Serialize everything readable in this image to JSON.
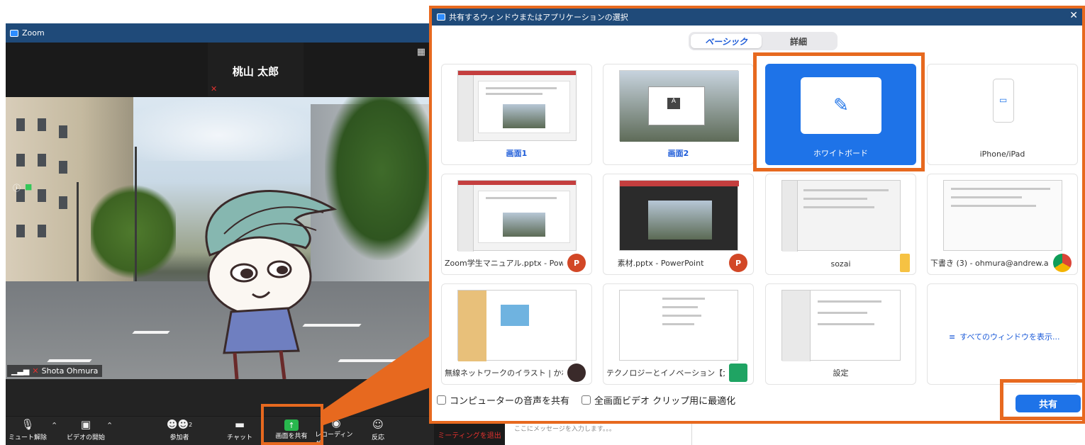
{
  "zoom_window": {
    "title": "Zoom",
    "speaker_name": "桃山 太郎",
    "participant_name": "Shota Ohmura",
    "toolbar": {
      "mute": "ミュート解除",
      "video": "ビデオの開始",
      "participants": "参加者",
      "participants_count": "2",
      "chat": "チャット",
      "share": "画面を共有",
      "record": "レコーディング",
      "reactions": "反応"
    },
    "leave": "ミーティングを退出",
    "chat_placeholder": "ここにメッセージを入力します。。。"
  },
  "share_dialog": {
    "title": "共有するウィンドウまたはアプリケーションの選択",
    "tabs": {
      "basic": "ベーシック",
      "advanced": "詳細"
    },
    "tiles": [
      {
        "label": "画面1"
      },
      {
        "label": "画面2"
      },
      {
        "label": "ホワイトボード"
      },
      {
        "label": "iPhone/iPad"
      },
      {
        "label": "Zoom学生マニュアル.pptx - Powe..."
      },
      {
        "label": "素材.pptx - PowerPoint"
      },
      {
        "label": "sozai"
      },
      {
        "label": "下書き (3) - ohmura@andrew.ac..."
      },
      {
        "label": "無線ネットワークのイラスト | かわい..."
      },
      {
        "label": "テクノロジーとイノベーション【大村..."
      },
      {
        "label": "設定"
      }
    ],
    "show_all": "すべてのウィンドウを表示...",
    "screen2_thumb_letter": "A",
    "badge_p": "P",
    "checkbox_audio": "コンピューターの音声を共有",
    "checkbox_video": "全画面ビデオ クリップ用に最適化",
    "share_button": "共有"
  },
  "colors": {
    "highlight": "#e7691f",
    "accent": "#1e73e8",
    "titlebar": "#1f4a79"
  }
}
